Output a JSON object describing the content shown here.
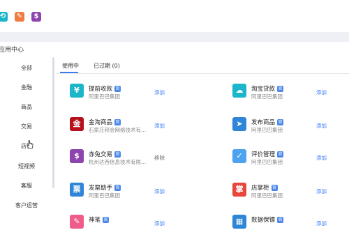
{
  "topbar": {
    "icons": [
      {
        "name": "teal-app-icon",
        "color": "#1bb6c9",
        "glyph": "⟲"
      },
      {
        "name": "orange-app-icon",
        "color": "#f07b3f",
        "glyph": "✎"
      },
      {
        "name": "purple-dollar-app-icon",
        "color": "#8e44ad",
        "glyph": "$"
      }
    ]
  },
  "app_center": {
    "title": "应用中心"
  },
  "sidebar": {
    "items": [
      {
        "label": "全部"
      },
      {
        "label": "金融"
      },
      {
        "label": "商品"
      },
      {
        "label": "交易"
      },
      {
        "label": "店铺"
      },
      {
        "label": "短视频"
      },
      {
        "label": "客服"
      },
      {
        "label": "客户运营"
      }
    ]
  },
  "tabs": [
    {
      "label": "使用中"
    },
    {
      "label": "已过期 (0)"
    }
  ],
  "cards": [
    {
      "name": "提前收款",
      "sub": "阿里巴巴集团",
      "action": "添加",
      "icon": "prepay-icon",
      "color": "#1bb6c9",
      "glyph": "¥"
    },
    {
      "name": "淘宝贷款",
      "sub": "阿里巴巴集团",
      "action": "添加",
      "icon": "loan-cloud-icon",
      "color": "#1bb6c9",
      "glyph": "☁"
    },
    {
      "name": "金淘商品",
      "sub": "石家庄邦金网络技术有...",
      "action": "添加",
      "icon": "jintao-logo-icon",
      "color": "#b5121b",
      "glyph": "金"
    },
    {
      "name": "发布商品",
      "sub": "阿里巴巴集团",
      "action": "添加",
      "icon": "publish-send-icon",
      "color": "#2f86d6",
      "glyph": "➤"
    },
    {
      "name": "赤兔交易",
      "sub": "杭州达西信息技术有限...",
      "action": "移除",
      "icon": "chitu-dollar-icon",
      "color": "#8e44ad",
      "glyph": "$"
    },
    {
      "name": "评价管理",
      "sub": "阿里巴巴集团",
      "action": "添加",
      "icon": "review-shield-icon",
      "color": "#4da3f0",
      "glyph": "✓"
    },
    {
      "name": "发票助手",
      "sub": "阿里巴巴集团",
      "action": "添加",
      "icon": "invoice-icon",
      "color": "#2f86d6",
      "glyph": "票"
    },
    {
      "name": "店掌柜",
      "sub": "阿里巴巴集团",
      "action": "添加",
      "icon": "store-manager-icon",
      "color": "#e8473d",
      "glyph": "掌"
    },
    {
      "name": "神笔",
      "sub": "",
      "action": "添加",
      "icon": "pen-icon",
      "color": "#ef5c8a",
      "glyph": "✎"
    },
    {
      "name": "数据保镖",
      "sub": "",
      "action": "添加",
      "icon": "data-guard-icon",
      "color": "#2f86d6",
      "glyph": "▦"
    }
  ],
  "badge_glyph": "官"
}
